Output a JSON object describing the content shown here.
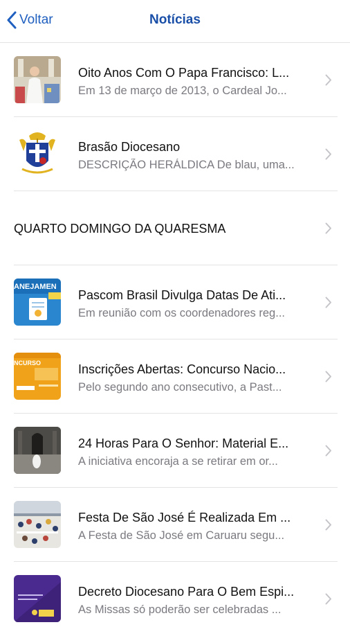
{
  "nav": {
    "back_label": "Voltar",
    "title": "Notícias",
    "accent": "#1f5fbf"
  },
  "news": [
    {
      "title": "Oito Anos Com O Papa Francisco: L...",
      "subtitle": "Em 13 de março de 2013, o Cardeal Jo...",
      "thumb": "pope-photo"
    },
    {
      "title": "Brasão Diocesano",
      "subtitle": "DESCRIÇÃO HERÁLDICA De blau, uma...",
      "thumb": "coat-of-arms"
    },
    {
      "title": "QUARTO DOMINGO DA QUARESMA",
      "subtitle": "",
      "thumb": ""
    },
    {
      "title": "Pascom Brasil Divulga Datas De Ati...",
      "subtitle": "Em reunião com os coordenadores reg...",
      "thumb": "planejamento-banner",
      "thumb_text": "ANEJAMEN"
    },
    {
      "title": "Inscrições Abertas: Concurso Nacio...",
      "subtitle": "Pelo segundo ano consecutivo, a Past...",
      "thumb": "concurso-banner",
      "thumb_text": "NCURSO"
    },
    {
      "title": "24 Horas Para O Senhor: Material E...",
      "subtitle": "A iniciativa encoraja a se retirar em or...",
      "thumb": "church-photo"
    },
    {
      "title": "Festa De São José É Realizada Em ...",
      "subtitle": "A Festa de São José em Caruaru segu...",
      "thumb": "festa-photo"
    },
    {
      "title": "Decreto Diocesano Para O Bem Espi...",
      "subtitle": "As Missas só poderão ser celebradas ...",
      "thumb": "decreto-banner"
    }
  ]
}
